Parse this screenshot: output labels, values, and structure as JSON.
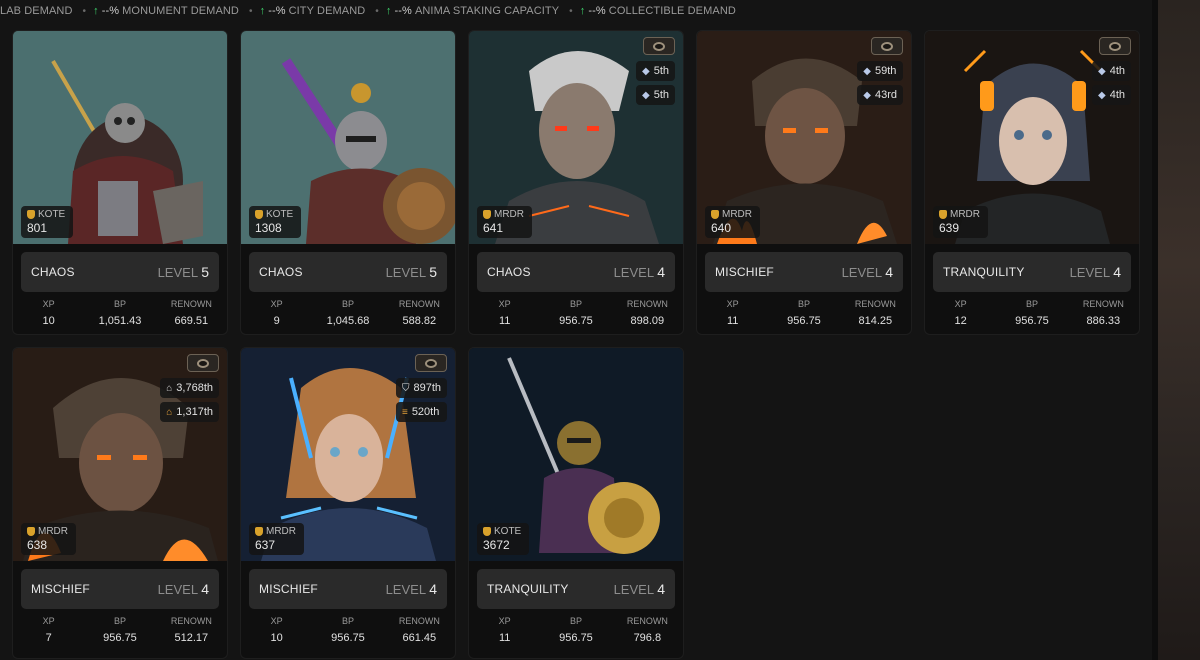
{
  "demand_bar": [
    {
      "label": "LAB DEMAND",
      "value": ""
    },
    {
      "label": "MONUMENT DEMAND",
      "value": "--%"
    },
    {
      "label": "CITY DEMAND",
      "value": "--%"
    },
    {
      "label": "ANIMA STAKING CAPACITY",
      "value": "--%"
    },
    {
      "label": "COLLECTIBLE DEMAND",
      "value": "--%"
    }
  ],
  "stat_headers": {
    "xp": "XP",
    "bp": "BP",
    "renown": "RENOWN"
  },
  "level_word": "LEVEL",
  "cards": [
    {
      "token": "KOTE",
      "id": "801",
      "faction": "CHAOS",
      "level": "5",
      "xp": "10",
      "bp": "1,051.43",
      "renown": "669.51",
      "ranks": []
    },
    {
      "token": "KOTE",
      "id": "1308",
      "faction": "CHAOS",
      "level": "5",
      "xp": "9",
      "bp": "1,045.68",
      "renown": "588.82",
      "ranks": []
    },
    {
      "token": "MRDR",
      "id": "641",
      "faction": "CHAOS",
      "level": "4",
      "xp": "11",
      "bp": "956.75",
      "renown": "898.09",
      "ranks": [
        {
          "icon": "gem-icon",
          "text": "5th"
        },
        {
          "icon": "gem-icon",
          "text": "5th"
        }
      ]
    },
    {
      "token": "MRDR",
      "id": "640",
      "faction": "MISCHIEF",
      "level": "4",
      "xp": "11",
      "bp": "956.75",
      "renown": "814.25",
      "ranks": [
        {
          "icon": "gem-icon",
          "text": "59th"
        },
        {
          "icon": "gem-icon",
          "text": "43rd"
        }
      ]
    },
    {
      "token": "MRDR",
      "id": "639",
      "faction": "TRANQUILITY",
      "level": "4",
      "xp": "12",
      "bp": "956.75",
      "renown": "886.33",
      "ranks": [
        {
          "icon": "gem-icon",
          "text": "4th"
        },
        {
          "icon": "gem-icon",
          "text": "4th"
        }
      ]
    },
    {
      "token": "MRDR",
      "id": "638",
      "faction": "MISCHIEF",
      "level": "4",
      "xp": "7",
      "bp": "956.75",
      "renown": "512.17",
      "ranks": [
        {
          "icon": "house-icon",
          "text": "3,768th"
        },
        {
          "icon": "house-orange-icon",
          "text": "1,317th"
        }
      ]
    },
    {
      "token": "MRDR",
      "id": "637",
      "faction": "MISCHIEF",
      "level": "4",
      "xp": "10",
      "bp": "956.75",
      "renown": "661.45",
      "ranks": [
        {
          "icon": "shield-icon",
          "text": "897th"
        },
        {
          "icon": "bars-icon",
          "text": "520th"
        }
      ]
    },
    {
      "token": "KOTE",
      "id": "3672",
      "faction": "TRANQUILITY",
      "level": "4",
      "xp": "11",
      "bp": "956.75",
      "renown": "796.8",
      "ranks": []
    }
  ],
  "colors": {
    "accent_up": "#3dd16b",
    "token_shield": "#d9a22b",
    "card_bg": "#0f0f0f",
    "level_bar": "#2a2a2a"
  }
}
